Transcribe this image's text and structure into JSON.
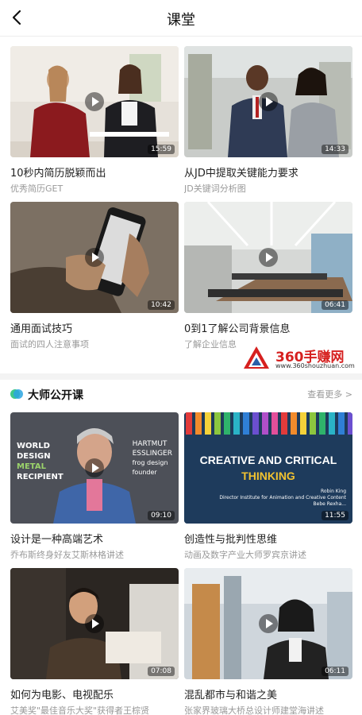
{
  "header": {
    "title": "课堂"
  },
  "courses": [
    {
      "title": "10秒内简历脱颖而出",
      "subtitle": "优秀简历GET",
      "duration": "15:59"
    },
    {
      "title": "从JD中提取关键能力要求",
      "subtitle": "JD关键词分析图",
      "duration": "14:33"
    },
    {
      "title": "通用面试技巧",
      "subtitle": "面试的四人注意事项",
      "duration": "10:42"
    },
    {
      "title": "0到1了解公司背景信息",
      "subtitle": "了解企业信息",
      "duration": "06:41"
    }
  ],
  "watermark": {
    "brand": "360手赚网",
    "url": "www.360shouzhuan.com"
  },
  "master_section": {
    "title": "大师公开课",
    "more_label": "查看更多 >",
    "courses": [
      {
        "title": "设计是一种高端艺术",
        "subtitle": "乔布斯终身好友艾斯林格讲述",
        "duration": "09:10",
        "thumb_text": [
          "WORLD",
          "DESIGN",
          "METAL",
          "RECIPIENT",
          "HARTMUT",
          "ESSLINGER",
          "frog design",
          "founder"
        ]
      },
      {
        "title": "创造性与批判性思维",
        "subtitle": "动画及数字产业大师罗宾京讲述",
        "duration": "11:55",
        "thumb_text": [
          "CREATIVE AND CRITICAL",
          "THINKING",
          "Robin King",
          "Director Institute for Animation and Creative Content",
          "Bebe Rexha..."
        ]
      },
      {
        "title": "如何为电影、电视配乐",
        "subtitle": "艾美奖\"最佳音乐大奖\"获得者王棕贤",
        "duration": "07:08"
      },
      {
        "title": "混乱都市与和谐之美",
        "subtitle": "张家界玻璃大桥总设计师建堂海讲述",
        "duration": "06:11"
      }
    ]
  }
}
